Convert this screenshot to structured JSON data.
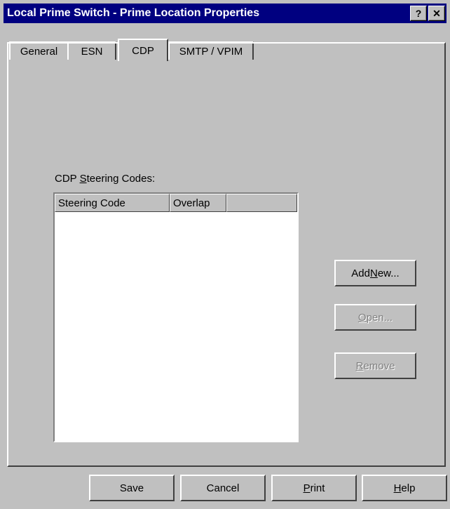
{
  "window": {
    "title": "Local Prime Switch - Prime Location Properties",
    "help_btn": "?",
    "close_btn": "✕"
  },
  "tabs": [
    {
      "label": "General",
      "active": false
    },
    {
      "label": "ESN",
      "active": false
    },
    {
      "label": "CDP",
      "active": true
    },
    {
      "label": "SMTP / VPIM",
      "active": false
    }
  ],
  "cdp": {
    "group_label_pre": "CDP ",
    "group_label_u": "S",
    "group_label_post": "teering Codes:",
    "columns": [
      "Steering Code",
      "Overlap",
      ""
    ],
    "rows": []
  },
  "side_buttons": {
    "add_new_pre": "Add ",
    "add_new_u": "N",
    "add_new_post": "ew...",
    "open_u": "O",
    "open_post": "pen...",
    "remove_u": "R",
    "remove_post": "emove"
  },
  "footer": {
    "save": "Save",
    "cancel": "Cancel",
    "print_u": "P",
    "print_post": "rint",
    "help_u": "H",
    "help_post": "elp"
  }
}
